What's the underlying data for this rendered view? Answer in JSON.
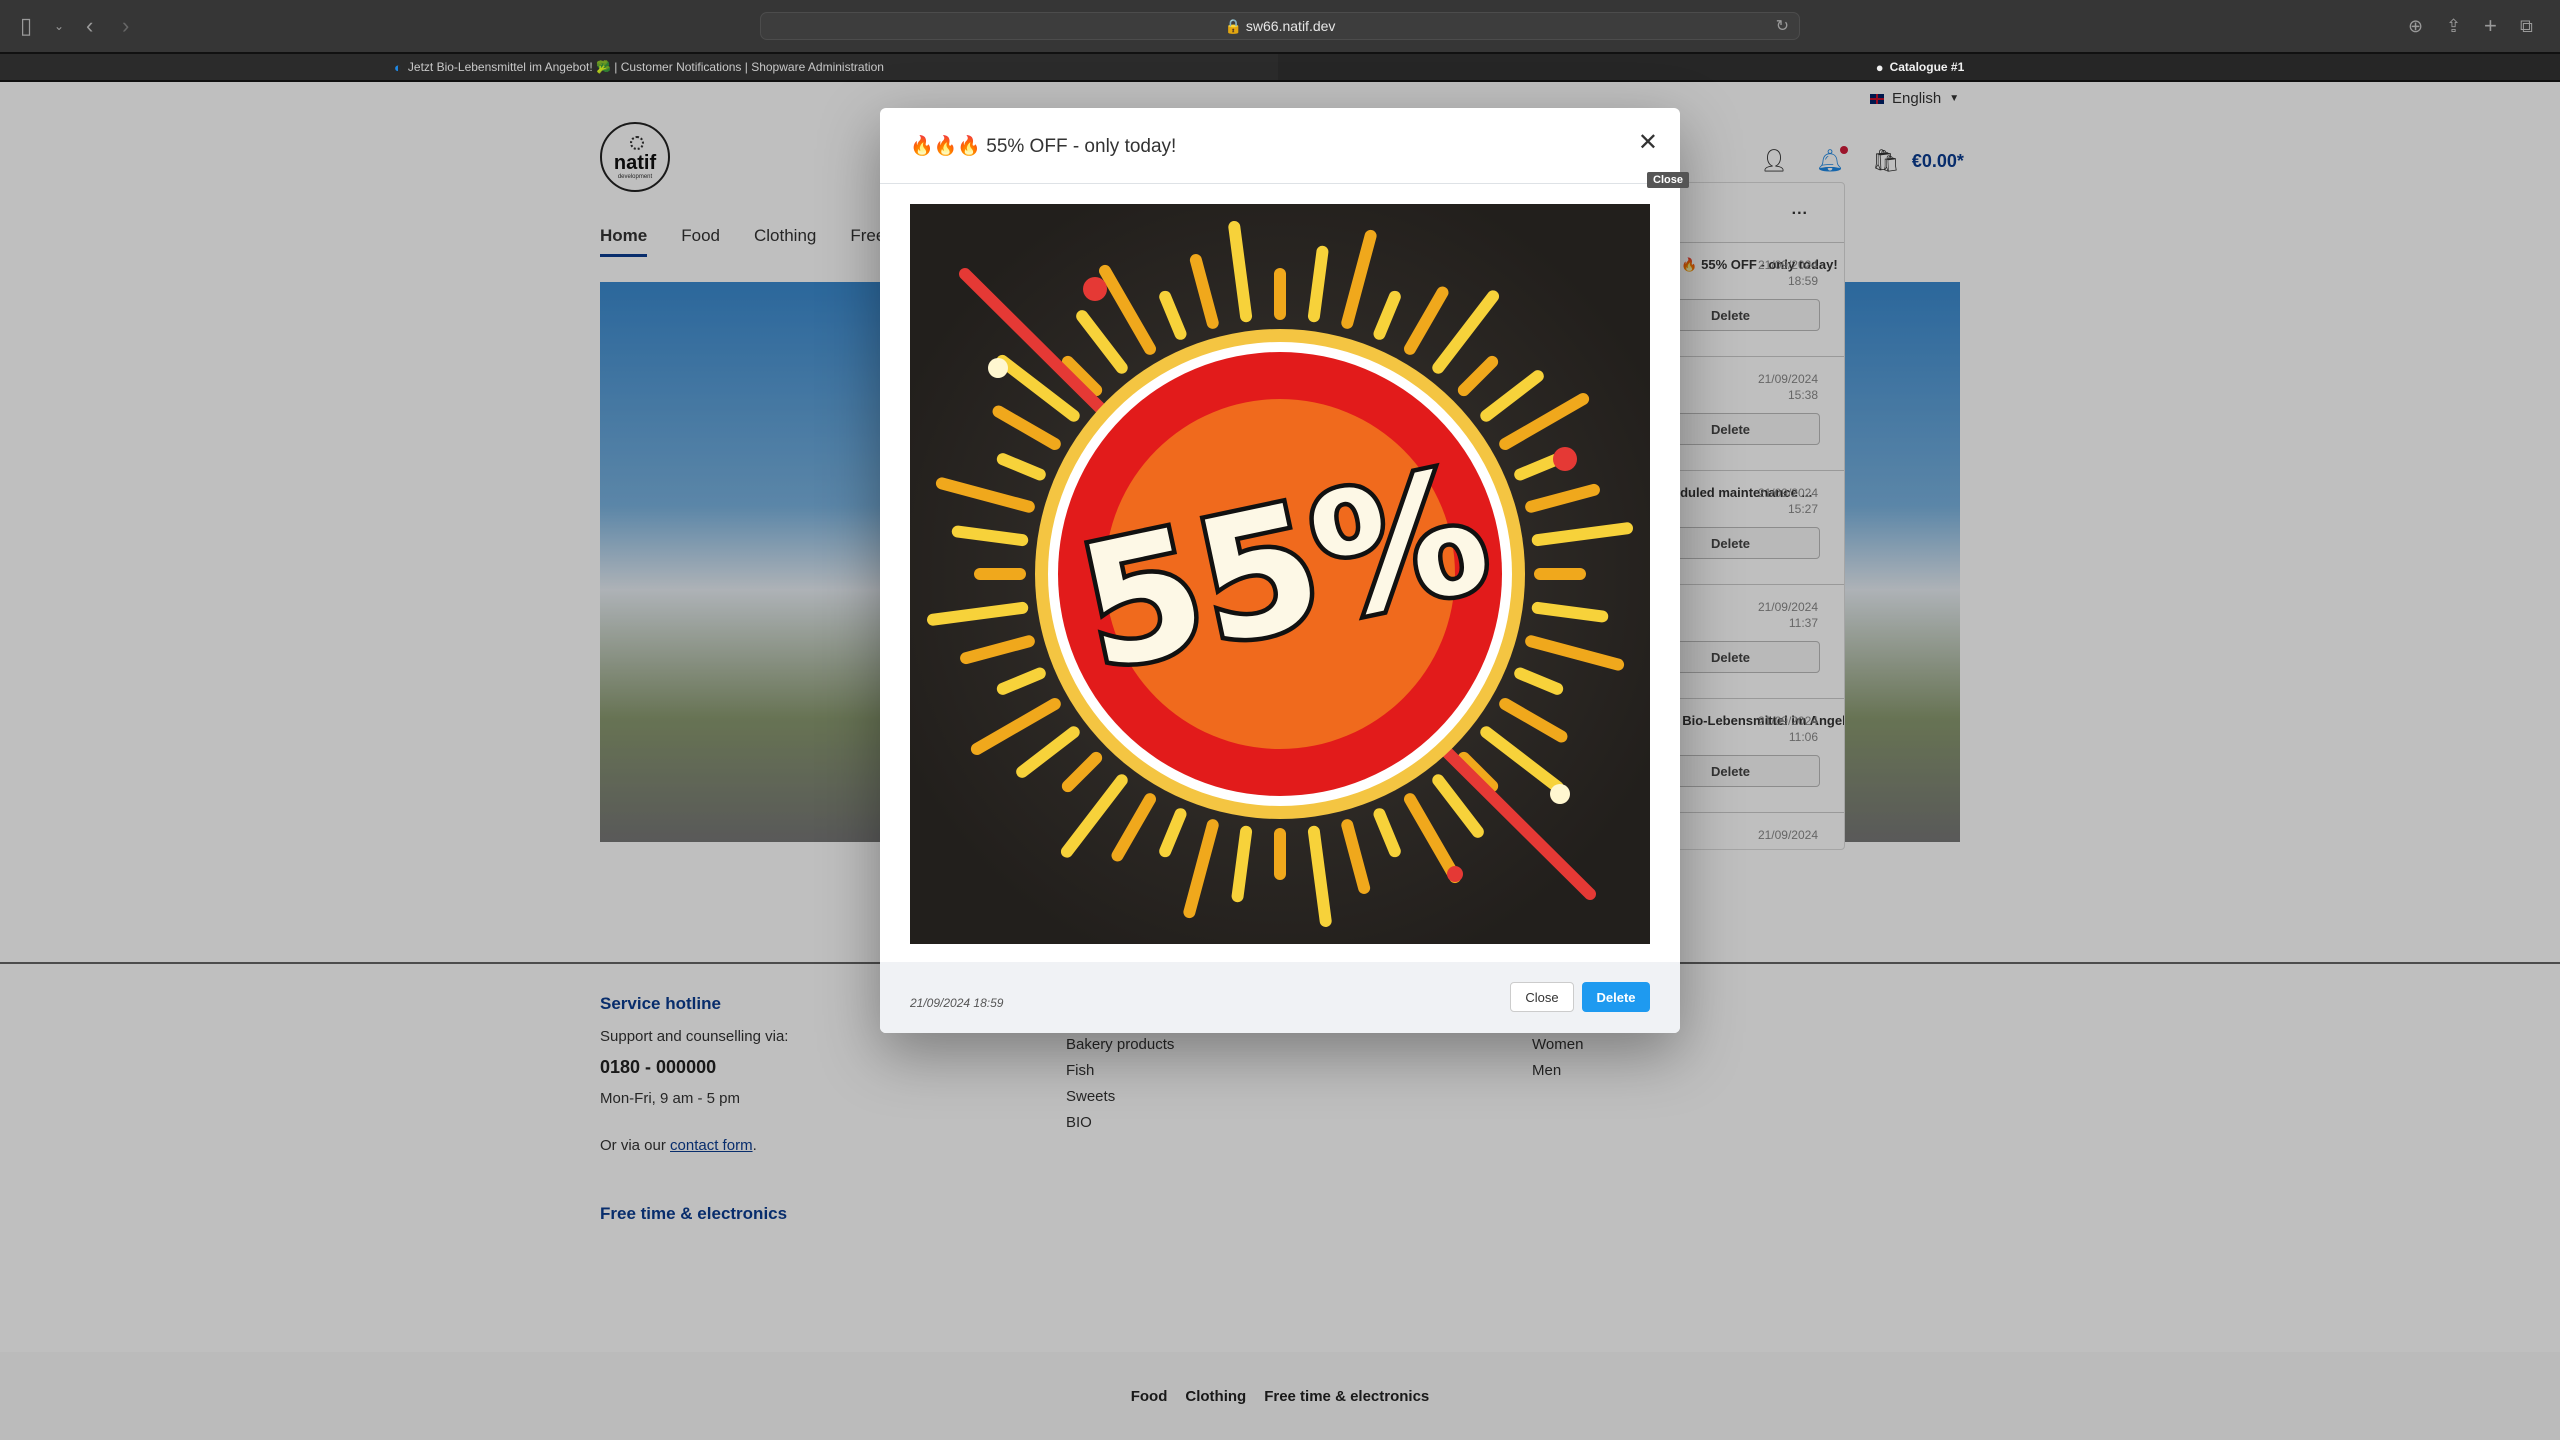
{
  "browser": {
    "url": "sw66.natif.dev",
    "tabs": [
      {
        "label": "Jetzt Bio-Lebensmittel im Angebot! 🥦 | Customer Notifications | Shopware Administration",
        "active": true
      },
      {
        "label": "Catalogue #1",
        "active": false
      }
    ]
  },
  "header": {
    "language": "English",
    "logo_text": "natif",
    "logo_subtext": "development",
    "cart_total": "€0.00*"
  },
  "nav": {
    "items": [
      "Home",
      "Food",
      "Clothing",
      "Free time & electronics"
    ]
  },
  "notifications": {
    "more_label": "...",
    "delete_label": "Delete",
    "items": [
      {
        "title": "🔥🔥🔥 55% OFF - only today!",
        "date": "21/09/2024",
        "time": "18:59"
      },
      {
        "title": "",
        "date": "21/09/2024",
        "time": "15:38"
      },
      {
        "title": "Scheduled maintenance ...",
        "date": "21/09/2024",
        "time": "15:27"
      },
      {
        "title": "!",
        "date": "21/09/2024",
        "time": "11:37"
      },
      {
        "title": "Jetzt Bio-Lebensmittel im Angebot! 🥦",
        "date": "21/09/2024",
        "time": "11:06"
      },
      {
        "title": "",
        "date": "21/09/2024",
        "time": ""
      }
    ]
  },
  "modal": {
    "title": "🔥🔥🔥 55% OFF - only today!",
    "image_text": "55%",
    "date": "21/09/2024 18:59",
    "close_label": "Close",
    "delete_label": "Delete",
    "close_tooltip": "Close"
  },
  "footer": {
    "service": {
      "heading": "Service hotline",
      "support": "Support and counselling via:",
      "phone": "0180 - 000000",
      "hours": "Mon-Fri, 9 am - 5 pm",
      "contact_prefix": "Or via our ",
      "contact_link": "contact form",
      "contact_suffix": "."
    },
    "food_items": [
      "Bakery products",
      "Fish",
      "Sweets",
      "BIO"
    ],
    "clothing_items": [
      "Women",
      "Men"
    ],
    "free_time_heading": "Free time & electronics",
    "bottom_links": [
      "Food",
      "Clothing",
      "Free time & electronics"
    ]
  }
}
